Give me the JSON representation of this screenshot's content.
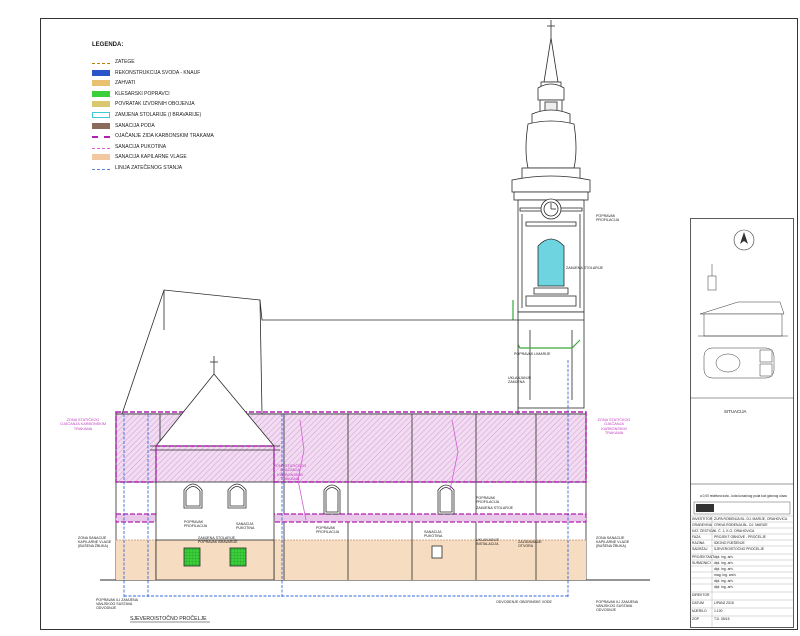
{
  "legend": {
    "title": "LEGENDA:",
    "items": [
      {
        "label": "ZATEGE",
        "color": "#b8860b"
      },
      {
        "label": "REKONSTRUKCIJA SVODA - KNAUF",
        "color": "#2a55c8"
      },
      {
        "label": "ZAHVATI",
        "color": "#e8c070"
      },
      {
        "label": "KLESARSKI POPRAVCI",
        "color": "#3ad03a"
      },
      {
        "label": "POVRATAK IZVORNIH OBOJENJA",
        "color": "#d8c870"
      },
      {
        "label": "ZAMJENA STOLARIJE (I BRAVARIJE)",
        "color": "#40c8d8"
      },
      {
        "label": "SANACIJA PODA",
        "color": "#8a6a5a"
      },
      {
        "label": "OJAČANJE ZIDA KARBONSKIM TRAKAMA",
        "color": "#b020b0"
      },
      {
        "label": "SANACIJA PUKOTINA",
        "color": "#d060d0"
      },
      {
        "label": "SANACIJA KAPILARNE VLAGE",
        "color": "#f3c8a0"
      },
      {
        "label": "LINIJA ZATEČENOG STANJA",
        "color": "#5a8ad0"
      }
    ]
  },
  "annotations": {
    "zone_left": "ZONA STATIČKOG OJAČANJA KARBONSKIM TRAKAMA",
    "zone_right": "ZONA STATIČKOG OJAČANJA KARBONSKIM TRAKAMA",
    "zone_mid": "ZONA STATIČKOG OJAČANJA KARBONSKIM TRAKAMA",
    "tower_plaster": "POPRAVAK PROFILACIJA",
    "tower_window": "ZAMJENA STOLARIJE",
    "tower_lower": "POPRAVAK LIMARIJE",
    "tower_drain": "UKLANJANJE ZAMJENA",
    "nave_prof": "POPRAVAK PROFILACIJA",
    "nave_window": "ZAMJENA STOLARIJE",
    "apse_prof": "POPRAVAK PROFILACIJA",
    "apse_crack": "SANACIJA PUKOTINA",
    "apse_window": "ZAMJENA STOLARIJE, POPRAVAK BRAVARIJE",
    "nave_prof2": "POPRAVAK PROFILACIJA",
    "crack2": "SANACIJA PUKOTINA",
    "install": "UKLANJANJE INSTALACIJA",
    "vent": "ZAZIDAVANJE OTVORA",
    "cap_left": "ZONA SANACIJE KAPILARNE VLAGE (BUŠENA ŽBUKA)",
    "cap_right": "ZONA SANACIJE KAPILARNE VLAGE (BUŠENA ŽBUKA)",
    "drain_left": "POPRAVAK ILI ZAMJENA VANJSKOG SUSTAVA ODVODNJE",
    "drain_mid": "ODVODENJE OBORINSKE VODE",
    "drain_right": "POPRAVAK ILI ZAMJENA VANJSKOG SUSTAVA ODVODNJE"
  },
  "view_title": "SJEVEROISTOČNO PROČELJE",
  "situation_label": "SITUACIJA",
  "scale_note": "a 0,00 relativna kota - kota konačnog poda kod glavnog ulaza",
  "title_block": {
    "company": "",
    "rows": [
      {
        "key": "INVESTITOR",
        "value": "ŽUPA ROĐENJA BL. DJ. MARIJE, ORAHOVICA"
      },
      {
        "key": "GRAĐEVINA",
        "value": "CRKVA ROĐENJA BL. DJ. MARIJE"
      },
      {
        "key": "KAT. ČESTICA",
        "value": "K. Č. 1, K.O. ORAHOVICA"
      },
      {
        "key": "FAZA",
        "value": "PROJEKT OBNOVE - PROČELJE"
      },
      {
        "key": "RAZINA",
        "value": "IDEJNO RJEŠENJE"
      },
      {
        "key": "SADRŽAJ",
        "value": "SJEVEROISTOČNO PROČELJE"
      }
    ],
    "people": [
      {
        "key": "PROJEKTANT",
        "value": "dipl. ing. arh."
      },
      {
        "key": "SURADNICI",
        "value": "dipl. ing. arh."
      },
      {
        "key": "",
        "value": "dipl. ing. arh."
      },
      {
        "key": "",
        "value": "mag. ing. arch."
      },
      {
        "key": "",
        "value": "dipl. ing. arh."
      },
      {
        "key": "",
        "value": "dipl. ing. arh."
      }
    ],
    "footer": [
      {
        "key": "DIREKTOR",
        "value": ""
      },
      {
        "key": "DATUM",
        "value": "LIPANJ 2015"
      },
      {
        "key": "MJERILO",
        "value": "1:100"
      },
      {
        "key": "ZOP",
        "value": "T.D. 05/15"
      }
    ]
  },
  "colors": {
    "line": "#2b2b2b",
    "carbon": "#b020b0",
    "zone_fill": "#e9c8e9",
    "capillary": "#f6dcc0",
    "tower_green": "#3aa83a",
    "drain_blue": "#3a6ad8",
    "window_cyan": "#5fd0e0"
  }
}
